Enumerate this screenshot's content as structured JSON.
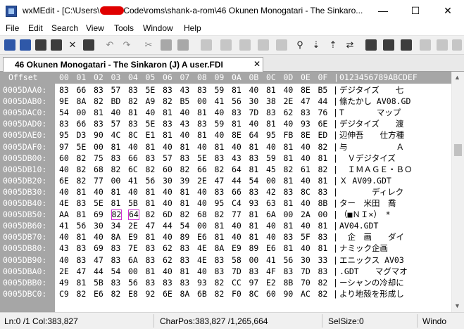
{
  "window": {
    "title_prefix": "wxMEdit - [C:\\Users\\",
    "title_suffix": "Code\\roms\\shank-a-rom\\46 Okunen Monogatari - The Sinkaro...",
    "minimize": "—",
    "maximize": "☐",
    "close": "✕"
  },
  "menu": [
    "File",
    "Edit",
    "Search",
    "View",
    "Tools",
    "Window",
    "Help"
  ],
  "toolbar_icons": [
    "new-file-icon",
    "open-file-icon",
    "save-icon",
    "save-all-icon",
    "close-file-icon",
    "close-all-icon",
    "undo-icon",
    "redo-icon",
    "cut-icon",
    "copy-icon",
    "paste-icon",
    "block-icon",
    "block-icon",
    "block-icon",
    "block-icon",
    "block-icon",
    "find-icon",
    "find-next-icon",
    "find-previous-icon",
    "replace-icon",
    "block-icon",
    "block-icon",
    "block-icon",
    "block-icon",
    "block-icon",
    "block-icon",
    "block-icon"
  ],
  "tab": {
    "label": "46 Okunen Monogatari - The Sinkaron (J) A user.FDI",
    "close": "✕"
  },
  "editor": {
    "header_offset": "Offset",
    "header_hex": [
      "00",
      "01",
      "02",
      "03",
      "04",
      "05",
      "06",
      "07",
      "08",
      "09",
      "0A",
      "0B",
      "0C",
      "0D",
      "0E",
      "0F"
    ],
    "header_text": "0123456789ABCDEF",
    "rows": [
      {
        "offset": "0005DAA0:",
        "bytes": [
          "83",
          "66",
          "83",
          "57",
          "83",
          "5E",
          "83",
          "43",
          "83",
          "59",
          "81",
          "40",
          "81",
          "40",
          "8E",
          "B5"
        ],
        "text": "デジタイズ　　七"
      },
      {
        "offset": "0005DAB0:",
        "bytes": [
          "9E",
          "8A",
          "82",
          "BD",
          "82",
          "A9",
          "82",
          "B5",
          "00",
          "41",
          "56",
          "30",
          "38",
          "2E",
          "47",
          "44"
        ],
        "text": "條たかし AV08.GD"
      },
      {
        "offset": "0005DAC0:",
        "bytes": [
          "54",
          "00",
          "81",
          "40",
          "81",
          "40",
          "81",
          "40",
          "81",
          "40",
          "83",
          "7D",
          "83",
          "62",
          "83",
          "76"
        ],
        "text": "T　　　　マップ"
      },
      {
        "offset": "0005DAD0:",
        "bytes": [
          "83",
          "66",
          "83",
          "57",
          "83",
          "5E",
          "83",
          "43",
          "83",
          "59",
          "81",
          "40",
          "81",
          "40",
          "93",
          "6E"
        ],
        "text": "デジタイズ　　渡"
      },
      {
        "offset": "0005DAE0:",
        "bytes": [
          "95",
          "D3",
          "90",
          "4C",
          "8C",
          "E1",
          "81",
          "40",
          "81",
          "40",
          "8E",
          "64",
          "95",
          "FB",
          "8E",
          "ED"
        ],
        "text": "辺伸吾　　仕方種"
      },
      {
        "offset": "0005DAF0:",
        "bytes": [
          "97",
          "5E",
          "00",
          "81",
          "40",
          "81",
          "40",
          "81",
          "40",
          "81",
          "40",
          "81",
          "40",
          "81",
          "40",
          "82"
        ],
        "text": "与　　　　　　Ａ"
      },
      {
        "offset": "0005DB00:",
        "bytes": [
          "60",
          "82",
          "75",
          "83",
          "66",
          "83",
          "57",
          "83",
          "5E",
          "83",
          "43",
          "83",
          "59",
          "81",
          "40",
          "81"
        ],
        "text": "　Ｖデジタイズ"
      },
      {
        "offset": "0005DB10:",
        "bytes": [
          "40",
          "82",
          "68",
          "82",
          "6C",
          "82",
          "60",
          "82",
          "66",
          "82",
          "64",
          "81",
          "45",
          "82",
          "61",
          "82"
        ],
        "text": "　ＩＭＡＧＥ・ＢＯ"
      },
      {
        "offset": "0005DB20:",
        "bytes": [
          "6E",
          "82",
          "77",
          "00",
          "41",
          "56",
          "30",
          "39",
          "2E",
          "47",
          "44",
          "54",
          "00",
          "81",
          "40",
          "81"
        ],
        "text": "Ｘ AV09.GDT"
      },
      {
        "offset": "0005DB30:",
        "bytes": [
          "40",
          "81",
          "40",
          "81",
          "40",
          "81",
          "40",
          "81",
          "40",
          "83",
          "66",
          "83",
          "42",
          "83",
          "8C",
          "83"
        ],
        "text": "　　　　ディレク"
      },
      {
        "offset": "0005DB40:",
        "bytes": [
          "4E",
          "83",
          "5E",
          "81",
          "5B",
          "81",
          "40",
          "81",
          "40",
          "95",
          "C4",
          "93",
          "63",
          "81",
          "40",
          "8B"
        ],
        "text": "ター　米田　喬"
      },
      {
        "offset": "0005DB50:",
        "bytes": [
          "AA",
          "81",
          "69",
          "82",
          "64",
          "82",
          "6D",
          "82",
          "68",
          "82",
          "77",
          "81",
          "6A",
          "00",
          "2A",
          "00"
        ],
        "text": "（■ＮＩ×）　*"
      },
      {
        "offset": "0005DB60:",
        "bytes": [
          "41",
          "56",
          "30",
          "34",
          "2E",
          "47",
          "44",
          "54",
          "00",
          "81",
          "40",
          "81",
          "40",
          "81",
          "40",
          "81"
        ],
        "text": "AV04.GDT"
      },
      {
        "offset": "0005DB70:",
        "bytes": [
          "40",
          "81",
          "40",
          "8A",
          "E9",
          "81",
          "40",
          "89",
          "E6",
          "81",
          "40",
          "81",
          "40",
          "83",
          "5F",
          "83"
        ],
        "text": "　企　画　　ダイ"
      },
      {
        "offset": "0005DB80:",
        "bytes": [
          "43",
          "83",
          "69",
          "83",
          "7E",
          "83",
          "62",
          "83",
          "4E",
          "8A",
          "E9",
          "89",
          "E6",
          "81",
          "40",
          "81"
        ],
        "text": "ナミック企画"
      },
      {
        "offset": "0005DB90:",
        "bytes": [
          "40",
          "83",
          "47",
          "83",
          "6A",
          "83",
          "62",
          "83",
          "4E",
          "83",
          "58",
          "00",
          "41",
          "56",
          "30",
          "33"
        ],
        "text": "エニックス AV03"
      },
      {
        "offset": "0005DBA0:",
        "bytes": [
          "2E",
          "47",
          "44",
          "54",
          "00",
          "81",
          "40",
          "81",
          "40",
          "83",
          "7D",
          "83",
          "4F",
          "83",
          "7D",
          "83"
        ],
        "text": ".GDT　　マグマオ"
      },
      {
        "offset": "0005DBB0:",
        "bytes": [
          "49",
          "81",
          "5B",
          "83",
          "56",
          "83",
          "83",
          "83",
          "93",
          "82",
          "CC",
          "97",
          "E2",
          "8B",
          "70",
          "82"
        ],
        "text": "ーシャンの冷却に"
      },
      {
        "offset": "0005DBC0:",
        "bytes": [
          "C9",
          "82",
          "E6",
          "82",
          "E8",
          "92",
          "6E",
          "8A",
          "6B",
          "82",
          "F0",
          "8C",
          "60",
          "90",
          "AC",
          "82"
        ],
        "text": "より地殻を形成し"
      }
    ]
  },
  "status": {
    "position": "Ln:0 /1 Col:383,827",
    "charpos": "CharPos:383,827 /1,265,664",
    "selsize": "SelSize:0",
    "eol": "Windo"
  }
}
